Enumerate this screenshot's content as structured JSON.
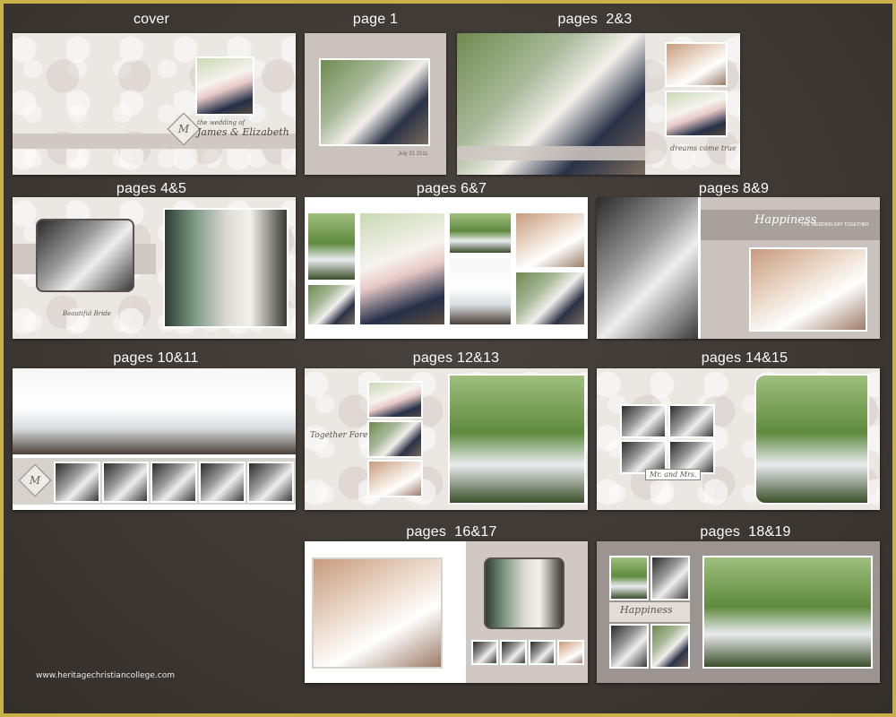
{
  "labels": {
    "cover": "cover",
    "page1": "page 1",
    "pages23": "pages  2&3",
    "pages45": "pages 4&5",
    "pages67": "pages 6&7",
    "pages89": "pages 8&9",
    "pages1011": "pages 10&11",
    "pages1213": "pages 12&13",
    "pages1415": "pages 14&15",
    "pages1617": "pages  16&17",
    "pages1819": "pages  18&19"
  },
  "cover": {
    "monogram": "M",
    "title_small": "the wedding of",
    "title_names": "James & Elizabeth"
  },
  "page1": {
    "date_text": "July 21 2011"
  },
  "pages23": {
    "script_text": "dreams come true"
  },
  "pages45": {
    "caption": "Beautiful Bride"
  },
  "pages89": {
    "script_text": "Happiness",
    "subtitle": "THE WEDDING DAY TOGETHER"
  },
  "pages1011": {
    "monogram": "M"
  },
  "pages1213": {
    "script_text": "Together Forever"
  },
  "pages1415": {
    "script_text": "Mr. and Mrs."
  },
  "pages1819": {
    "script_text": "Happiness"
  },
  "watermark": "www.heritagechristiancollege.com"
}
